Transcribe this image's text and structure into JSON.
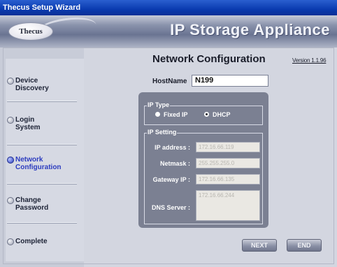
{
  "window": {
    "title": "Thecus Setup Wizard"
  },
  "banner": {
    "logo_text": "Thecus",
    "title": "IP Storage Appliance"
  },
  "sidebar": {
    "steps": [
      {
        "label": "Device\nDiscovery",
        "active": false
      },
      {
        "label": "Login\nSystem",
        "active": false
      },
      {
        "label": "Network\nConfiguration",
        "active": true
      },
      {
        "label": "Change\nPassword",
        "active": false
      },
      {
        "label": "Complete",
        "active": false
      }
    ]
  },
  "main": {
    "heading": "Network Configuration",
    "version": "Version 1.1.96",
    "hostname": {
      "label": "HostName",
      "value": "N199"
    },
    "ip_type": {
      "legend": "IP Type",
      "options": [
        {
          "label": "Fixed IP",
          "selected": false
        },
        {
          "label": "DHCP",
          "selected": true
        }
      ]
    },
    "ip_setting": {
      "legend": "IP Setting",
      "ip_address": {
        "label": "IP address :",
        "value": "172.16.66.119"
      },
      "netmask": {
        "label": "Netmask :",
        "value": "255.255.255.0"
      },
      "gateway": {
        "label": "Gateway IP :",
        "value": "172.16.66.135"
      },
      "dns": {
        "label": "DNS Server :",
        "value": "172.16.66.244"
      }
    },
    "buttons": {
      "next": "NEXT",
      "end": "END"
    }
  }
}
